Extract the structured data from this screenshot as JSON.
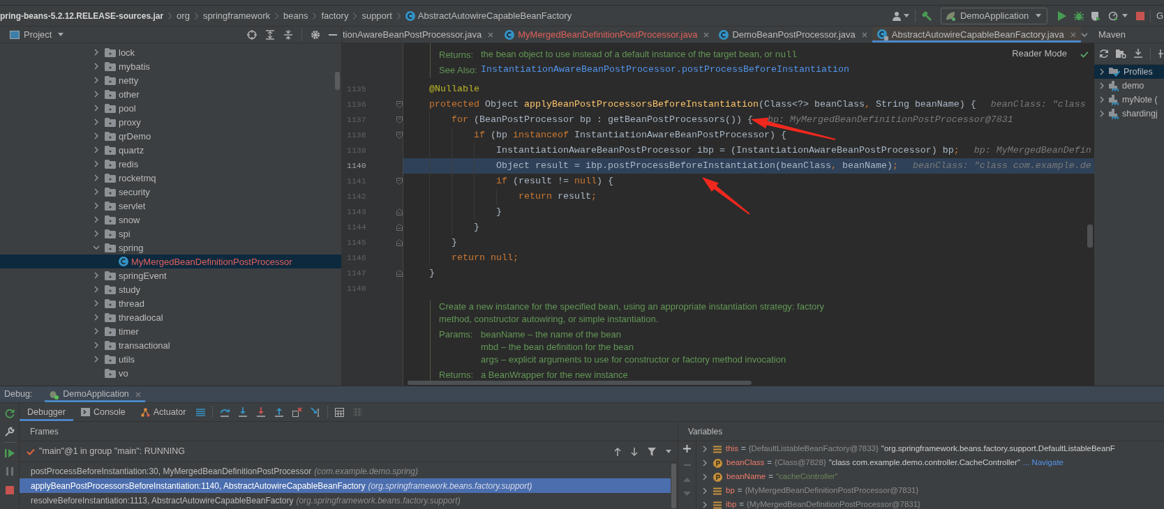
{
  "navigation_bar": {
    "breadcrumbs": [
      {
        "label": "pring-beans-5.2.12.RELEASE-sources.jar",
        "kind": "jar"
      },
      {
        "label": "org",
        "kind": "package"
      },
      {
        "label": "springframework",
        "kind": "package"
      },
      {
        "label": "beans",
        "kind": "package"
      },
      {
        "label": "factory",
        "kind": "package"
      },
      {
        "label": "support",
        "kind": "package"
      },
      {
        "label": "AbstractAutowireCapableBeanFactory",
        "kind": "class"
      }
    ],
    "run_configuration": "DemoApplication",
    "edge_text": "G"
  },
  "project_panel": {
    "title": "Project",
    "items": [
      {
        "label": "lock",
        "kind": "package",
        "expanded": false,
        "selected": false,
        "error": false
      },
      {
        "label": "mybatis",
        "kind": "package",
        "expanded": false,
        "selected": false,
        "error": false
      },
      {
        "label": "netty",
        "kind": "package",
        "expanded": false,
        "selected": false,
        "error": false
      },
      {
        "label": "other",
        "kind": "package",
        "expanded": false,
        "selected": false,
        "error": false
      },
      {
        "label": "pool",
        "kind": "package",
        "expanded": false,
        "selected": false,
        "error": false
      },
      {
        "label": "proxy",
        "kind": "package",
        "expanded": false,
        "selected": false,
        "error": false
      },
      {
        "label": "qrDemo",
        "kind": "package",
        "expanded": false,
        "selected": false,
        "error": false
      },
      {
        "label": "quartz",
        "kind": "package",
        "expanded": false,
        "selected": false,
        "error": false
      },
      {
        "label": "redis",
        "kind": "package",
        "expanded": false,
        "selected": false,
        "error": false
      },
      {
        "label": "rocketmq",
        "kind": "package",
        "expanded": false,
        "selected": false,
        "error": false
      },
      {
        "label": "security",
        "kind": "package",
        "expanded": false,
        "selected": false,
        "error": false
      },
      {
        "label": "servlet",
        "kind": "package",
        "expanded": false,
        "selected": false,
        "error": false
      },
      {
        "label": "snow",
        "kind": "package",
        "expanded": false,
        "selected": false,
        "error": false
      },
      {
        "label": "spi",
        "kind": "package",
        "expanded": false,
        "selected": false,
        "error": false
      },
      {
        "label": "spring",
        "kind": "package",
        "expanded": true,
        "selected": false,
        "error": false,
        "children": [
          {
            "label": "MyMergedBeanDefinitionPostProcessor",
            "kind": "class",
            "selected": true,
            "error": true
          }
        ]
      },
      {
        "label": "springEvent",
        "kind": "package",
        "expanded": false,
        "selected": false,
        "error": false
      },
      {
        "label": "study",
        "kind": "package",
        "expanded": false,
        "selected": false,
        "error": false
      },
      {
        "label": "thread",
        "kind": "package",
        "expanded": false,
        "selected": false,
        "error": false
      },
      {
        "label": "threadlocal",
        "kind": "package",
        "expanded": false,
        "selected": false,
        "error": false
      },
      {
        "label": "timer",
        "kind": "package",
        "expanded": false,
        "selected": false,
        "error": false
      },
      {
        "label": "transactional",
        "kind": "package",
        "expanded": false,
        "selected": false,
        "error": false
      },
      {
        "label": "utils",
        "kind": "package",
        "expanded": false,
        "selected": false,
        "error": false
      },
      {
        "label": "vo",
        "kind": "empty_package",
        "selected": false,
        "error": false
      }
    ]
  },
  "editor": {
    "tabs": [
      {
        "label": "tionAwareBeanPostProcessor.java",
        "kind": "truncated",
        "selected": false,
        "error": false
      },
      {
        "label": "MyMergedBeanDefinitionPostProcessor.java",
        "kind": "class",
        "selected": false,
        "error": true
      },
      {
        "label": "DemoBeanPostProcessor.java",
        "kind": "class",
        "selected": false,
        "error": false
      },
      {
        "label": "AbstractAutowireCapableBeanFactory.java",
        "kind": "library_class",
        "selected": true,
        "error": false
      }
    ],
    "reader_mode": "Reader Mode",
    "doc_top": {
      "returns": {
        "label": "Returns:",
        "text": "the bean object to use instead of a default instance of the target bean, or",
        "code": "null"
      },
      "see_also": {
        "label": "See Also:",
        "link": "InstantiationAwareBeanPostProcessor.postProcessBeforeInstantiation"
      }
    },
    "lines": [
      {
        "number": "1135",
        "current": false,
        "tokens": [
          {
            "text": "    @Nullable",
            "kind": "annotation"
          }
        ]
      },
      {
        "number": "1136",
        "current": false,
        "fold_start": true,
        "tokens": [
          {
            "text": "    protected",
            "kind": "keyword"
          },
          {
            "text": " Object ",
            "kind": "plain"
          },
          {
            "text": "applyBeanPostProcessorsBeforeInstantiation",
            "kind": "method"
          },
          {
            "text": "(Class<?> beanClass",
            "kind": "plain"
          },
          {
            "text": ",",
            "kind": "keyword"
          },
          {
            "text": " String beanName) {",
            "kind": "plain"
          }
        ],
        "hint": "beanClass: \"class"
      },
      {
        "number": "1137",
        "current": false,
        "fold_start": true,
        "tokens": [
          {
            "text": "        for",
            "kind": "keyword"
          },
          {
            "text": " (BeanPostProcessor bp : getBeanPostProcessors()) {",
            "kind": "plain"
          }
        ],
        "hint": "bp: MyMergedBeanDefinitionPostProcessor@7831"
      },
      {
        "number": "1138",
        "current": false,
        "fold_start": true,
        "tokens": [
          {
            "text": "            if",
            "kind": "keyword"
          },
          {
            "text": " (bp ",
            "kind": "plain"
          },
          {
            "text": "instanceof",
            "kind": "keyword"
          },
          {
            "text": " InstantiationAwareBeanPostProcessor) {",
            "kind": "plain"
          }
        ]
      },
      {
        "number": "1139",
        "current": false,
        "tokens": [
          {
            "text": "                InstantiationAwareBeanPostProcessor ibp = (InstantiationAwareBeanPostProcessor) bp",
            "kind": "plain"
          },
          {
            "text": ";",
            "kind": "keyword"
          }
        ],
        "hint": "bp: MyMergedBeanDefin"
      },
      {
        "number": "1140",
        "current": true,
        "tokens": [
          {
            "text": "                Object result = ibp.postProcessBeforeInstantiation(beanClass",
            "kind": "plain"
          },
          {
            "text": ",",
            "kind": "keyword"
          },
          {
            "text": " beanName)",
            "kind": "plain"
          },
          {
            "text": ";",
            "kind": "keyword"
          }
        ],
        "hint": "beanClass: \"class com.example.de"
      },
      {
        "number": "1141",
        "current": false,
        "fold_start": true,
        "tokens": [
          {
            "text": "                if",
            "kind": "keyword"
          },
          {
            "text": " (result != ",
            "kind": "plain"
          },
          {
            "text": "null",
            "kind": "keyword"
          },
          {
            "text": ") {",
            "kind": "plain"
          }
        ]
      },
      {
        "number": "1142",
        "current": false,
        "tokens": [
          {
            "text": "                    return",
            "kind": "keyword"
          },
          {
            "text": " result",
            "kind": "plain"
          },
          {
            "text": ";",
            "kind": "keyword"
          }
        ]
      },
      {
        "number": "1143",
        "current": false,
        "fold_end": true,
        "tokens": [
          {
            "text": "                }",
            "kind": "plain"
          }
        ]
      },
      {
        "number": "1144",
        "current": false,
        "fold_end": true,
        "tokens": [
          {
            "text": "            }",
            "kind": "plain"
          }
        ]
      },
      {
        "number": "1145",
        "current": false,
        "fold_end": true,
        "tokens": [
          {
            "text": "        }",
            "kind": "plain"
          }
        ]
      },
      {
        "number": "1146",
        "current": false,
        "tokens": [
          {
            "text": "        return null;",
            "kind": "keyword"
          }
        ]
      },
      {
        "number": "1147",
        "current": false,
        "fold_end": true,
        "tokens": [
          {
            "text": "    }",
            "kind": "plain"
          }
        ]
      },
      {
        "number": "1148",
        "current": false
      }
    ],
    "doc_bottom": {
      "description": "Create a new instance for the specified bean, using an appropriate instantiation strategy: factory method, constructor autowiring, or simple instantiation.",
      "params_label": "Params:",
      "params": [
        "beanName – the name of the bean",
        "mbd – the bean definition for the bean",
        "args – explicit arguments to use for constructor or factory method invocation"
      ],
      "returns_label": "Returns:",
      "returns_text": "a BeanWrapper for the new instance"
    }
  },
  "maven_panel": {
    "title": "Maven",
    "items": [
      {
        "label": "Profiles",
        "kind": "profiles",
        "expanded": false,
        "selected": true
      },
      {
        "label": "demo",
        "kind": "module",
        "expanded": false,
        "selected": false
      },
      {
        "label": "myNote (",
        "kind": "module",
        "expanded": false,
        "selected": false
      },
      {
        "label": "shardingj",
        "kind": "module",
        "expanded": false,
        "selected": false
      }
    ]
  },
  "debug": {
    "title": "Debug:",
    "session": "DemoApplication",
    "tabs": [
      {
        "label": "Debugger",
        "kind": "debugger",
        "selected": true
      },
      {
        "label": "Console",
        "kind": "console",
        "selected": false
      },
      {
        "label": "Actuator",
        "kind": "actuator",
        "selected": false
      }
    ],
    "frames": {
      "title": "Frames",
      "thread": "\"main\"@1 in group \"main\": RUNNING",
      "items": [
        {
          "location": "postProcessBeforeInstantiation:30, MyMergedBeanDefinitionPostProcessor",
          "package": "(com.example.demo.spring)",
          "selected": false
        },
        {
          "location": "applyBeanPostProcessorsBeforeInstantiation:1140, AbstractAutowireCapableBeanFactory",
          "package": "(org.springframework.beans.factory.support)",
          "selected": true
        },
        {
          "location": "resolveBeforeInstantiation:1113, AbstractAutowireCapableBeanFactory",
          "package": "(org.springframework.beans.factory.support)",
          "selected": false
        }
      ]
    },
    "variables": {
      "title": "Variables",
      "items": [
        {
          "name": "this",
          "kind": "field",
          "expandable": true,
          "sign": "=",
          "type": "{DefaultListableBeanFactory@7833}",
          "value": "\"org.springframework.beans.factory.support.DefaultListableBeanF"
        },
        {
          "name": "beanClass",
          "kind": "parameter",
          "expandable": true,
          "sign": "=",
          "type": "{Class@7828}",
          "value": "\"class com.example.demo.controller.CacheController\"",
          "link": "... Navigate"
        },
        {
          "name": "beanName",
          "kind": "parameter",
          "expandable": true,
          "sign": "=",
          "string": "\"cacheController\""
        },
        {
          "name": "bp",
          "kind": "field",
          "expandable": true,
          "sign": "=",
          "type": "{MyMergedBeanDefinitionPostProcessor@7831}"
        },
        {
          "name": "ibp",
          "kind": "field",
          "expandable": true,
          "sign": "=",
          "type": "{MyMergedBeanDefinitionPostProcessor@7831}"
        }
      ]
    }
  }
}
